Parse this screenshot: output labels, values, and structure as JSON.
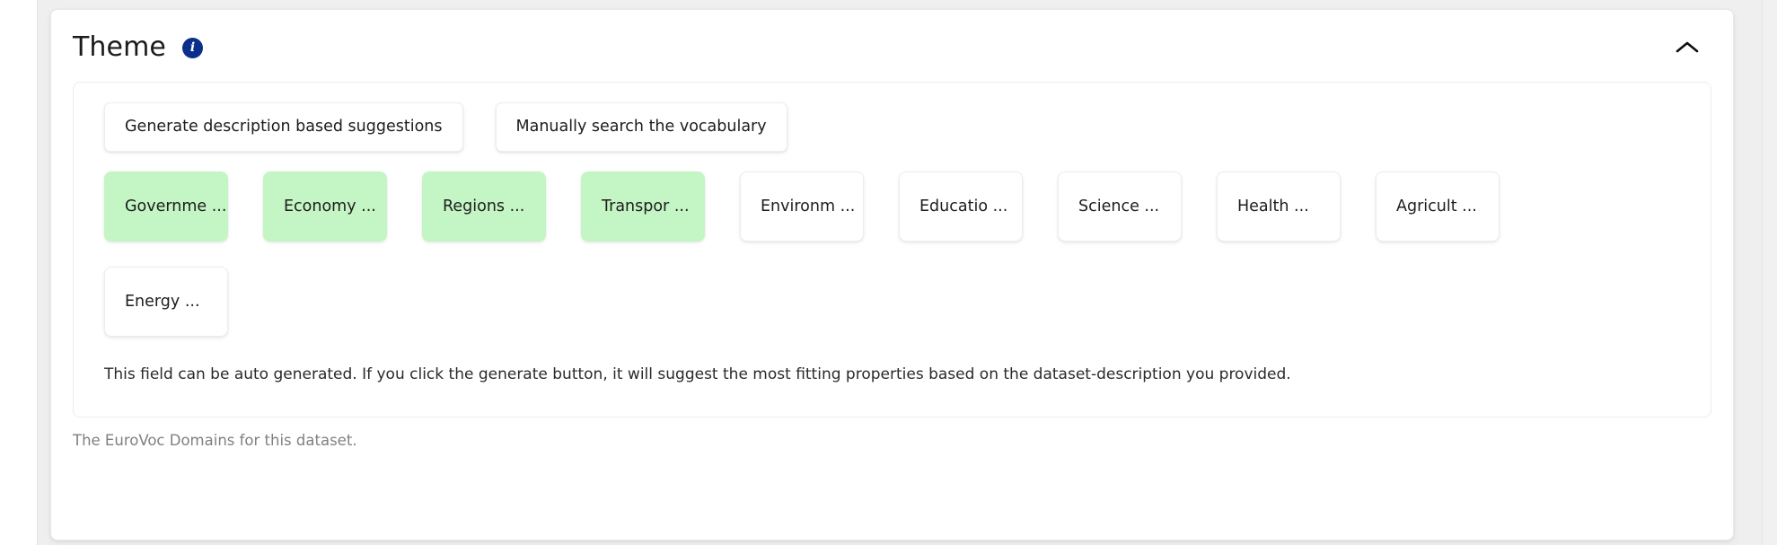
{
  "card": {
    "title": "Theme",
    "info_icon": "info-icon",
    "collapse_icon": "chevron-up-icon",
    "footer_hint": "The EuroVoc Domains for this dataset."
  },
  "actions": [
    {
      "label": "Generate description based suggestions",
      "name": "generate-suggestions-button"
    },
    {
      "label": "Manually search the vocabulary",
      "name": "manual-search-button"
    }
  ],
  "chips": [
    {
      "label": "Governme ...",
      "selected": true
    },
    {
      "label": "Economy ...",
      "selected": true
    },
    {
      "label": "Regions ...",
      "selected": true
    },
    {
      "label": "Transpor ...",
      "selected": true
    },
    {
      "label": "Environm ...",
      "selected": false
    },
    {
      "label": "Educatio ...",
      "selected": false
    },
    {
      "label": "Science ...",
      "selected": false
    },
    {
      "label": "Health ...",
      "selected": false
    },
    {
      "label": "Agricult ...",
      "selected": false
    },
    {
      "label": "Energy ...",
      "selected": false
    }
  ],
  "helper_text": "This field can be auto generated. If you click the generate button, it will suggest the most fitting properties based on the dataset-description you provided.",
  "colors": {
    "chip_selected_bg": "#c4f5c4",
    "info_badge": "#0b2f8a",
    "shell_bg": "#efefef",
    "card_bg": "#ffffff",
    "footer_text": "#808080"
  }
}
